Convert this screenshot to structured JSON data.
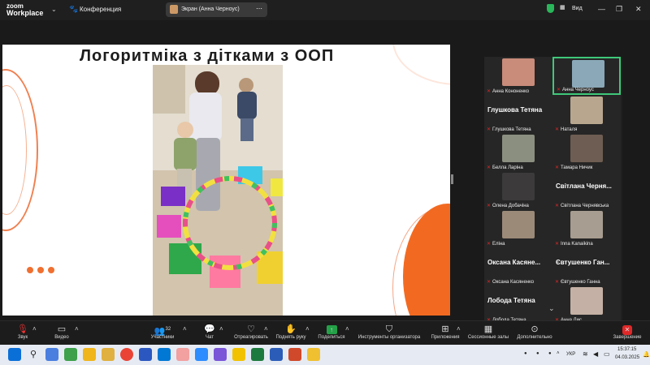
{
  "titlebar": {
    "logo_top": "zoom",
    "logo_bottom": "Workplace",
    "conference_label": "Конференция",
    "screen_share_label": "Экран (Анна Черноус)",
    "view_label": "Вид"
  },
  "slide": {
    "title": "Логоритміка з дітками з ООП"
  },
  "gallery": {
    "tiles": [
      {
        "name": "Анна Кононенко",
        "thumb_color": "#c98b7a"
      },
      {
        "name": "Анна Черноус",
        "thumb_color": "#8aa8b8"
      },
      {
        "name": "Глушкова Тетяна",
        "big": "Глушкова Тетяна"
      },
      {
        "name": "Наталя",
        "thumb_color": "#b8a68e"
      },
      {
        "name": "Белла Ларіна",
        "thumb_color": "#8b8f80"
      },
      {
        "name": "Тамара Ничик",
        "thumb_color": "#6e5d52"
      },
      {
        "name": "Олена Добачіна",
        "thumb_color": "#3c3a3a"
      },
      {
        "name": "Світлана Чернявська",
        "big": "Світлана Черня..."
      },
      {
        "name": "Еліна",
        "thumb_color": "#9b8a78"
      },
      {
        "name": "Inna Kanaikina",
        "thumb_color": "#a79d90"
      },
      {
        "name": "Оксана Касяненко",
        "big": "Оксана Касяне..."
      },
      {
        "name": "Євтушенко Ганна",
        "big": "Євтушенко Ган..."
      },
      {
        "name": "Лобода Тетяна",
        "big": "Лобода Тетяна"
      },
      {
        "name": "Анна Лис",
        "thumb_color": "#c4b0a4"
      }
    ]
  },
  "toolbar": {
    "audio": "Звук",
    "video": "Видео",
    "participants": "Участники",
    "participants_count": "32",
    "chat": "Чат",
    "react": "Отреагировать",
    "raise_hand": "Поднять руку",
    "share": "Поделиться",
    "host_tools": "Инструменты организатора",
    "apps": "Приложения",
    "breakout": "Сессионные залы",
    "more": "Дополнительно",
    "end": "Завершение"
  },
  "taskbar": {
    "lang": "УКР",
    "time": "15:37:15",
    "date": "04.03.2025"
  }
}
